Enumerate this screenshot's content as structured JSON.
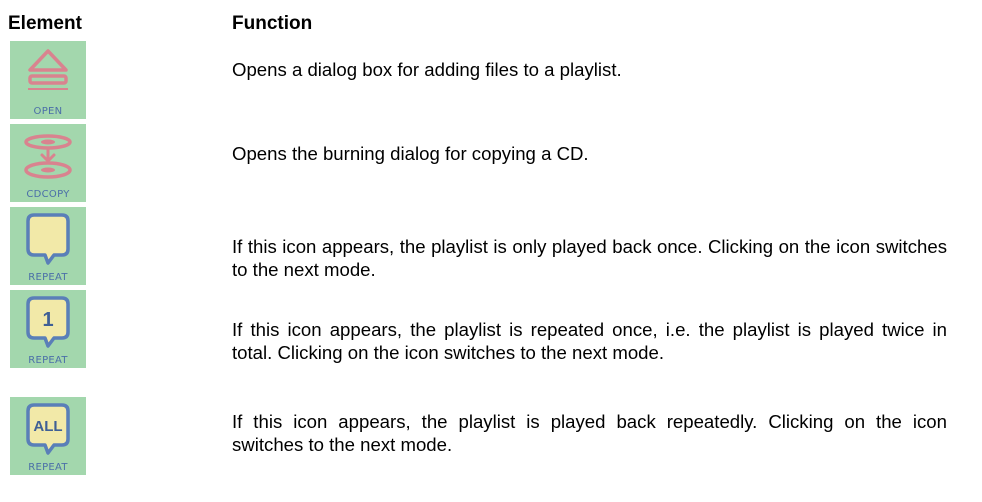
{
  "headers": {
    "element": "Element",
    "function": "Function"
  },
  "colors": {
    "tile_background": "#a3d7ad",
    "icon_face": "#f2e9a8",
    "icon_outline": "#5a7fb8",
    "open_icon": "#d9838f",
    "caption_text": "#4b6fa8"
  },
  "rows": [
    {
      "icon": "eject-open-icon",
      "caption": "OPEN",
      "description": "Opens a dialog box for adding files to a playlist."
    },
    {
      "icon": "cd-copy-icon",
      "caption": "CDCOPY",
      "description": "Opens the burning dialog for copying a CD."
    },
    {
      "icon": "repeat-off-icon",
      "caption": "REPEAT",
      "description": "If this icon appears, the playlist is only played back once. Clicking on the icon switches to the next mode."
    },
    {
      "icon": "repeat-one-icon",
      "caption": "REPEAT",
      "badge": "1",
      "description": "If this icon appears, the playlist is repeated once, i.e. the playlist is played twice in total. Clicking on the icon switches to the next mode."
    },
    {
      "icon": "repeat-all-icon",
      "caption": "REPEAT",
      "badge": "ALL",
      "description": "If this icon appears, the playlist is played back repeatedly. Clicking on the icon switches to the next mode."
    }
  ]
}
